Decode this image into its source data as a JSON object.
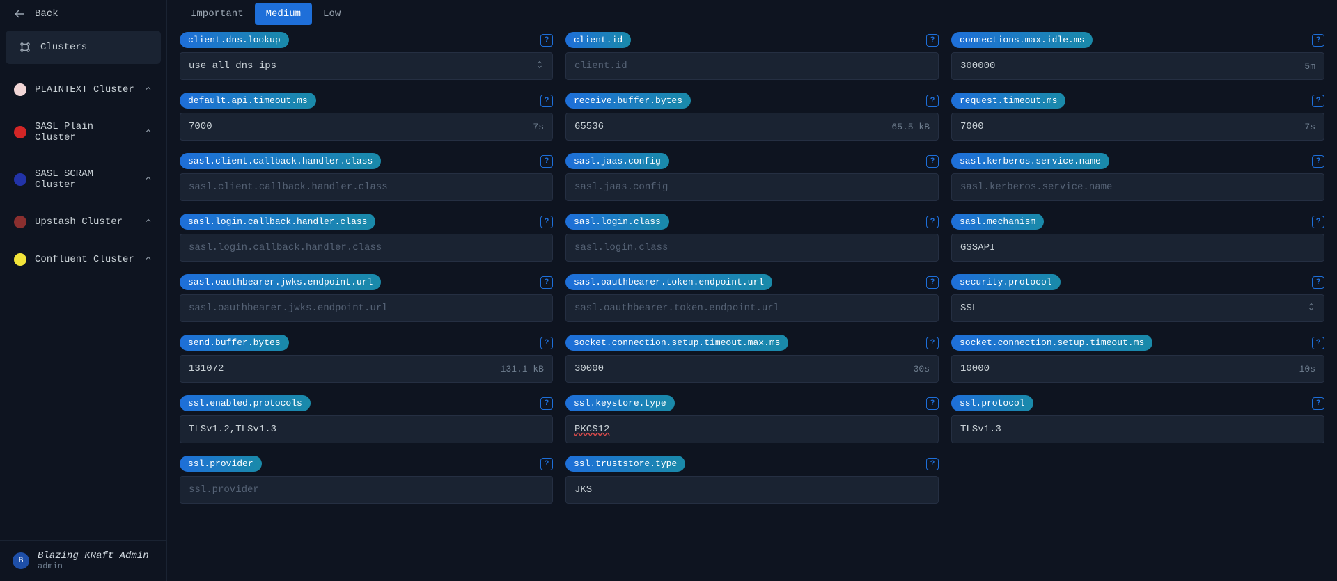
{
  "sidebar": {
    "back_label": "Back",
    "section_label": "Clusters",
    "clusters": [
      {
        "label": "PLAINTEXT Cluster",
        "color": "#f1d6d6"
      },
      {
        "label": "SASL Plain Cluster",
        "color": "#d22626"
      },
      {
        "label": "SASL SCRAM Cluster",
        "color": "#2233a8"
      },
      {
        "label": "Upstash Cluster",
        "color": "#8a2f2f"
      },
      {
        "label": "Confluent Cluster",
        "color": "#f2e43a"
      }
    ],
    "user": {
      "avatar_initial": "B",
      "name": "Blazing KRaft Admin",
      "role": "admin"
    }
  },
  "tabs": [
    {
      "label": "Important",
      "active": false
    },
    {
      "label": "Medium",
      "active": true
    },
    {
      "label": "Low",
      "active": false
    }
  ],
  "configs": [
    {
      "key": "client.dns.lookup",
      "value": "use all dns ips",
      "type": "select"
    },
    {
      "key": "client.id",
      "placeholder": "client.id",
      "type": "text"
    },
    {
      "key": "connections.max.idle.ms",
      "value": "300000",
      "suffix": "5m",
      "type": "text"
    },
    {
      "key": "default.api.timeout.ms",
      "value": "7000",
      "suffix": "7s",
      "type": "text"
    },
    {
      "key": "receive.buffer.bytes",
      "value": "65536",
      "suffix": "65.5 kB",
      "type": "text"
    },
    {
      "key": "request.timeout.ms",
      "value": "7000",
      "suffix": "7s",
      "type": "text"
    },
    {
      "key": "sasl.client.callback.handler.class",
      "placeholder": "sasl.client.callback.handler.class",
      "type": "text"
    },
    {
      "key": "sasl.jaas.config",
      "placeholder": "sasl.jaas.config",
      "type": "text"
    },
    {
      "key": "sasl.kerberos.service.name",
      "placeholder": "sasl.kerberos.service.name",
      "type": "text"
    },
    {
      "key": "sasl.login.callback.handler.class",
      "placeholder": "sasl.login.callback.handler.class",
      "type": "text"
    },
    {
      "key": "sasl.login.class",
      "placeholder": "sasl.login.class",
      "type": "text"
    },
    {
      "key": "sasl.mechanism",
      "value": "GSSAPI",
      "type": "text"
    },
    {
      "key": "sasl.oauthbearer.jwks.endpoint.url",
      "placeholder": "sasl.oauthbearer.jwks.endpoint.url",
      "type": "text"
    },
    {
      "key": "sasl.oauthbearer.token.endpoint.url",
      "placeholder": "sasl.oauthbearer.token.endpoint.url",
      "type": "text"
    },
    {
      "key": "security.protocol",
      "value": "SSL",
      "type": "select"
    },
    {
      "key": "send.buffer.bytes",
      "value": "131072",
      "suffix": "131.1 kB",
      "type": "text"
    },
    {
      "key": "socket.connection.setup.timeout.max.ms",
      "value": "30000",
      "suffix": "30s",
      "type": "text"
    },
    {
      "key": "socket.connection.setup.timeout.ms",
      "value": "10000",
      "suffix": "10s",
      "type": "text"
    },
    {
      "key": "ssl.enabled.protocols",
      "value": "TLSv1.2,TLSv1.3",
      "type": "text"
    },
    {
      "key": "ssl.keystore.type",
      "value": "PKCS12",
      "type": "text",
      "spellerror": true
    },
    {
      "key": "ssl.protocol",
      "value": "TLSv1.3",
      "type": "text"
    },
    {
      "key": "ssl.provider",
      "placeholder": "ssl.provider",
      "type": "text"
    },
    {
      "key": "ssl.truststore.type",
      "value": "JKS",
      "type": "text"
    },
    null
  ]
}
